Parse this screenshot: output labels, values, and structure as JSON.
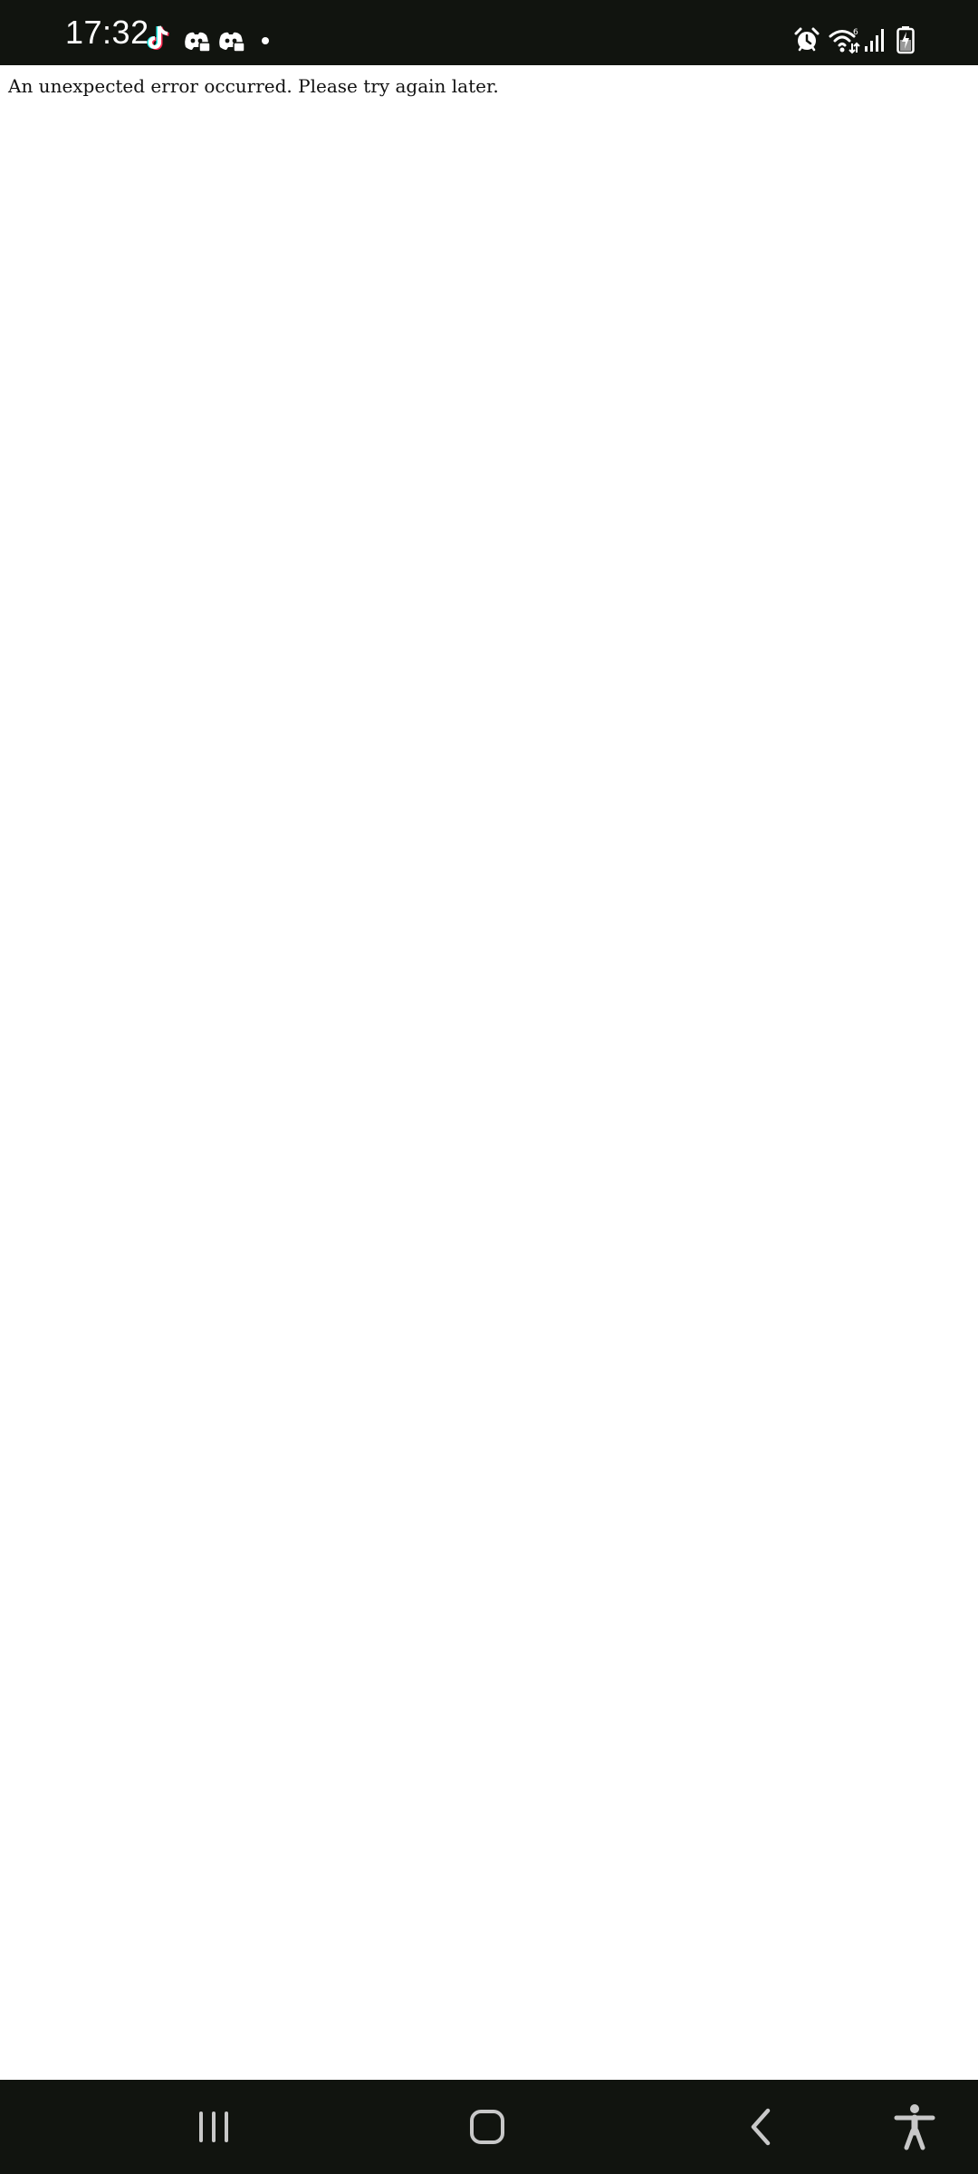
{
  "status_bar": {
    "time": "17:32",
    "colors": {
      "background": "#11140f",
      "foreground": "#ffffff"
    },
    "left_icons": [
      "tiktok-icon",
      "discord-icon",
      "discord-icon",
      "more-notifications-dot"
    ],
    "right_icons": [
      "alarm-icon",
      "wifi-icon",
      "cellular-signal-icon",
      "battery-charging-icon"
    ]
  },
  "page": {
    "error_text": "An unexpected error occurred. Please try again later."
  },
  "nav_bar": {
    "colors": {
      "background": "#11140f",
      "foreground": "#c8c8c8"
    },
    "buttons": [
      "recent-apps",
      "home",
      "back",
      "accessibility"
    ]
  }
}
